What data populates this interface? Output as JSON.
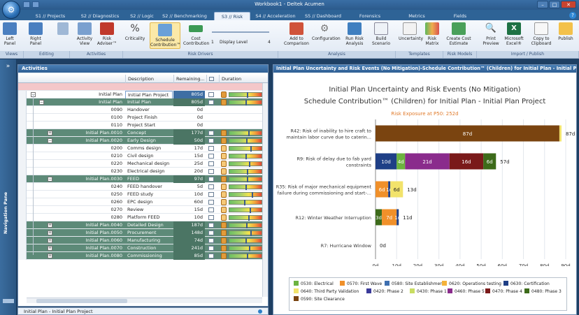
{
  "window": {
    "title": "Workbook1 - Deltek Acumen"
  },
  "tabs": [
    "S1 // Projects",
    "S2 // Diagnostics",
    "S2 // Logic",
    "S2 // Benchmarking",
    "S3 // Risk",
    "S4 // Acceleration",
    "S5 // Dashboard",
    "Forensics",
    "Metrics",
    "Fields"
  ],
  "active_tab_index": 4,
  "ribbon": {
    "buttons": [
      {
        "label": "Left Panel"
      },
      {
        "label": "Right Panel"
      },
      {
        "label": "Activity View"
      },
      {
        "label": "Risk Adviser™"
      },
      {
        "label": "Criticality"
      },
      {
        "label": "Schedule Contribution™"
      },
      {
        "label": "Cost Contribution"
      },
      {
        "label": "Display Level"
      },
      {
        "label": "Add to Comparison"
      },
      {
        "label": "Configuration"
      },
      {
        "label": "Run Risk Analysis"
      },
      {
        "label": "Build Scenario"
      },
      {
        "label": "Uncertainty"
      },
      {
        "label": "Risk Matrix"
      },
      {
        "label": "Create Cost Estimate"
      },
      {
        "label": "Print Preview"
      },
      {
        "label": "Microsoft Excel®"
      },
      {
        "label": "Copy to Clipboard"
      },
      {
        "label": "Publish"
      }
    ],
    "slider": {
      "min_label": "1",
      "max_label": "4",
      "value": "1"
    },
    "groups": [
      "Views",
      "Editing",
      "Activities",
      "Risk Drivers",
      "Analysis",
      "Templates",
      "Risk Models",
      "Import / Publish"
    ]
  },
  "nav_pane": {
    "label": "Navigation Pane"
  },
  "activities": {
    "title": "Activities",
    "columns": [
      "Description",
      "Remaining...",
      "",
      "Duration Uncertainty"
    ],
    "rows": [
      {
        "code": "Initial  Plan",
        "desc": "Initial  Plan Project",
        "rem": "805d",
        "level": 0,
        "group": true
      },
      {
        "code": "Initial  Plan",
        "desc": "Initial  Plan",
        "rem": "805d",
        "level": 1,
        "group": true
      },
      {
        "code": "0090",
        "desc": "Handover",
        "rem": "0d",
        "level": 2
      },
      {
        "code": "0100",
        "desc": "Project Finish",
        "rem": "0d",
        "level": 2
      },
      {
        "code": "0110",
        "desc": "Project Start",
        "rem": "0d",
        "level": 2
      },
      {
        "code": "Initial  Plan.0010",
        "desc": "Concept",
        "rem": "177d",
        "level": 2,
        "group": true
      },
      {
        "code": "Initial  Plan.0020",
        "desc": "Early Design",
        "rem": "50d",
        "level": 2,
        "group": true
      },
      {
        "code": "0200",
        "desc": "Comms design",
        "rem": "17d",
        "level": 3
      },
      {
        "code": "0210",
        "desc": "Civil design",
        "rem": "15d",
        "level": 3
      },
      {
        "code": "0220",
        "desc": "Mechanical design",
        "rem": "25d",
        "level": 3
      },
      {
        "code": "0230",
        "desc": "Electrical design",
        "rem": "20d",
        "level": 3
      },
      {
        "code": "Initial  Plan.0030",
        "desc": "FEED",
        "rem": "97d",
        "level": 2,
        "group": true
      },
      {
        "code": "0240",
        "desc": "FEED handover",
        "rem": "5d",
        "level": 3
      },
      {
        "code": "0250",
        "desc": "FEED study",
        "rem": "10d",
        "level": 3
      },
      {
        "code": "0260",
        "desc": "EPC design",
        "rem": "60d",
        "level": 3
      },
      {
        "code": "0270",
        "desc": "Review",
        "rem": "15d",
        "level": 3
      },
      {
        "code": "0280",
        "desc": "Platform FEED",
        "rem": "10d",
        "level": 3
      },
      {
        "code": "Initial  Plan.0040",
        "desc": "Detailed Design",
        "rem": "187d",
        "level": 2,
        "group": true
      },
      {
        "code": "Initial  Plan.0050",
        "desc": "Procurement",
        "rem": "148d",
        "level": 2,
        "group": true
      },
      {
        "code": "Initial  Plan.0060",
        "desc": "Manufacturing",
        "rem": "74d",
        "level": 2,
        "group": true
      },
      {
        "code": "Initial  Plan.0070",
        "desc": "Construction",
        "rem": "241d",
        "level": 2,
        "group": true
      },
      {
        "code": "Initial  Plan.0080",
        "desc": "Commissioning",
        "rem": "85d",
        "level": 2,
        "group": true
      }
    ],
    "status": "Initial  Plan - Initial  Plan Project"
  },
  "chart_panel": {
    "header": "Initial  Plan Uncertainty and Risk Events (No Mitigation)-Schedule Contribution™ (Children) for Initial  Plan - Initial  Plan Project"
  },
  "chart_data": {
    "type": "bar",
    "orientation": "horizontal",
    "stacked": true,
    "title": "Initial  Plan Uncertainty and Risk Events (No Mitigation)",
    "subtitle": "Schedule Contribution™ (Children) for Initial  Plan - Initial  Plan Project",
    "annotation": "Risk Exposure at P50: 252d",
    "xlim": [
      0,
      90
    ],
    "xticks": [
      "0d",
      "10d",
      "20d",
      "30d",
      "40d",
      "50d",
      "60d",
      "70d",
      "80d",
      "90d"
    ],
    "categories": [
      "R42: Risk of inability to hire craft to maintain labor curve due to caterin...",
      "R9: Risk of delay due to fab yard constraints",
      "R35: Risk of major mechanical equipment failure during commissioning and start-...",
      "R12: Winter Weather Interruption",
      "R7: Hurricane Window"
    ],
    "category_lines": [
      [
        "R42: Risk of inability to hire craft to",
        "maintain labor curve due to caterin..."
      ],
      [
        "R9: Risk of delay due to fab yard",
        "constraints"
      ],
      [
        "R35: Risk of major mechanical equipment",
        "failure during commissioning and start-..."
      ],
      [
        "R12: Winter Weather Interruption"
      ],
      [
        "R7: Hurricane Window"
      ]
    ],
    "totals": [
      "87d",
      "57d",
      "13d",
      "11d",
      "0d"
    ],
    "bars": [
      [
        {
          "series": "0590: Site Clearance",
          "value": 87,
          "label": "87d"
        },
        {
          "series": "0640: Third Party Validation",
          "value": 1,
          "label": ""
        }
      ],
      [
        {
          "series": "0630: Certification",
          "value": 10,
          "label": "10d"
        },
        {
          "series": "0530: Electrical",
          "value": 4,
          "label": "4d"
        },
        {
          "series": "0460: Phase 5",
          "value": 21,
          "label": "21d"
        },
        {
          "series": "0470: Phase 4",
          "value": 16,
          "label": "16d"
        },
        {
          "series": "0480: Phase 3",
          "value": 6,
          "label": "6d"
        }
      ],
      [
        {
          "series": "0570: First Wave",
          "value": 6,
          "label": "6d"
        },
        {
          "series": "0630: Certification",
          "value": 1,
          "label": "1d"
        },
        {
          "series": "0640: Third Party Validation",
          "value": 6,
          "label": "6d"
        }
      ],
      [
        {
          "series": "0480: Phase 3",
          "value": 3,
          "label": "3d"
        },
        {
          "series": "0570: First Wave",
          "value": 7,
          "label": "7d"
        },
        {
          "series": "0630: Certification",
          "value": 1,
          "label": "1d"
        }
      ],
      []
    ],
    "legend": [
      {
        "name": "0530: Electrical",
        "color": "#6db33f"
      },
      {
        "name": "0570: First Wave",
        "color": "#f0902a"
      },
      {
        "name": "0580: Site Establishment",
        "color": "#3f6fb0"
      },
      {
        "name": "0620: Operations testing",
        "color": "#f4b23a"
      },
      {
        "name": "0630: Certification",
        "color": "#1f3f86"
      },
      {
        "name": "0640: Third Party Validation",
        "color": "#f2e36b"
      },
      {
        "name": "0420: Phase 2",
        "color": "#3a3a9a"
      },
      {
        "name": "0430: Phase 1",
        "color": "#c9dd62"
      },
      {
        "name": "0460: Phase 5",
        "color": "#8a2b8c"
      },
      {
        "name": "0470: Phase 4",
        "color": "#7a1a1a"
      },
      {
        "name": "0480: Phase 3",
        "color": "#3d6b1a"
      },
      {
        "name": "0590: Site Clearance",
        "color": "#7a4410"
      }
    ]
  }
}
